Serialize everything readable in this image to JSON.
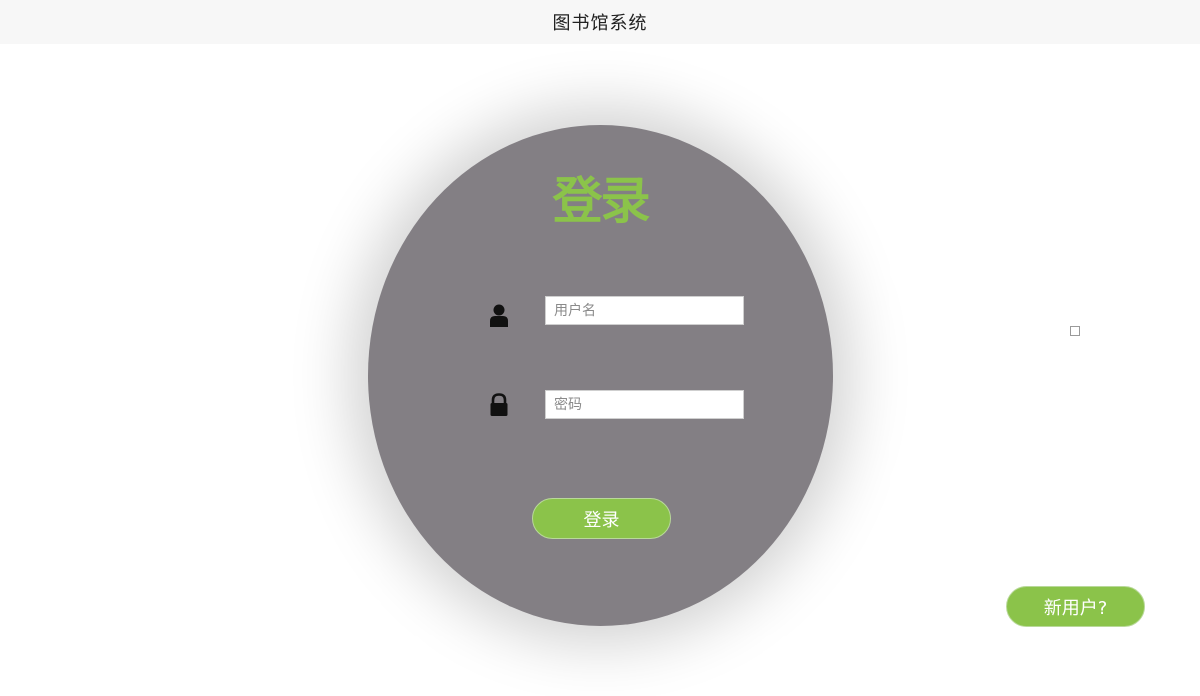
{
  "header": {
    "title": "图书馆系统"
  },
  "login_form": {
    "heading": "登录",
    "username": {
      "icon": "user-icon",
      "placeholder": "用户名",
      "value": ""
    },
    "password": {
      "icon": "lock-icon",
      "placeholder": "密码",
      "value": ""
    },
    "submit_label": "登录"
  },
  "footer_actions": {
    "new_user_label": "新用户?"
  },
  "colors": {
    "accent": "#8bc34a",
    "panel": "#837f84",
    "header_bg": "#f7f7f7"
  }
}
